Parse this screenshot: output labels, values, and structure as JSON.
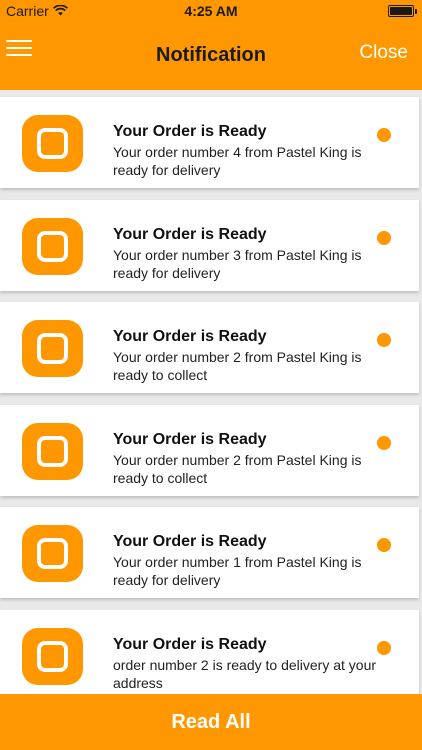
{
  "status_bar": {
    "carrier": "Carrier",
    "time": "4:25 AM",
    "wifi_icon": "wifi-icon",
    "battery_level": 1.0
  },
  "nav": {
    "title": "Notification",
    "close_label": "Close",
    "menu_icon": "hamburger-menu-icon"
  },
  "notifications": [
    {
      "title": "Your Order is Ready",
      "body": "Your order number 4 from Pastel King is ready for delivery",
      "unread": true
    },
    {
      "title": "Your Order is Ready",
      "body": "Your order number 3 from Pastel King is ready for delivery",
      "unread": true
    },
    {
      "title": "Your Order is Ready",
      "body": "Your order number 2 from Pastel King is ready to collect",
      "unread": true
    },
    {
      "title": "Your Order is Ready",
      "body": "Your order number 2 from Pastel King is ready to collect",
      "unread": true
    },
    {
      "title": "Your Order is Ready",
      "body": "Your order number 1 from Pastel King is ready for delivery",
      "unread": true
    },
    {
      "title": "Your Order is Ready",
      "body": "order number 2 is ready to delivery at your address",
      "unread": true
    }
  ],
  "footer": {
    "read_all_label": "Read All"
  },
  "colors": {
    "accent": "#ff9800",
    "background": "#e9e9e9",
    "card": "#ffffff"
  }
}
